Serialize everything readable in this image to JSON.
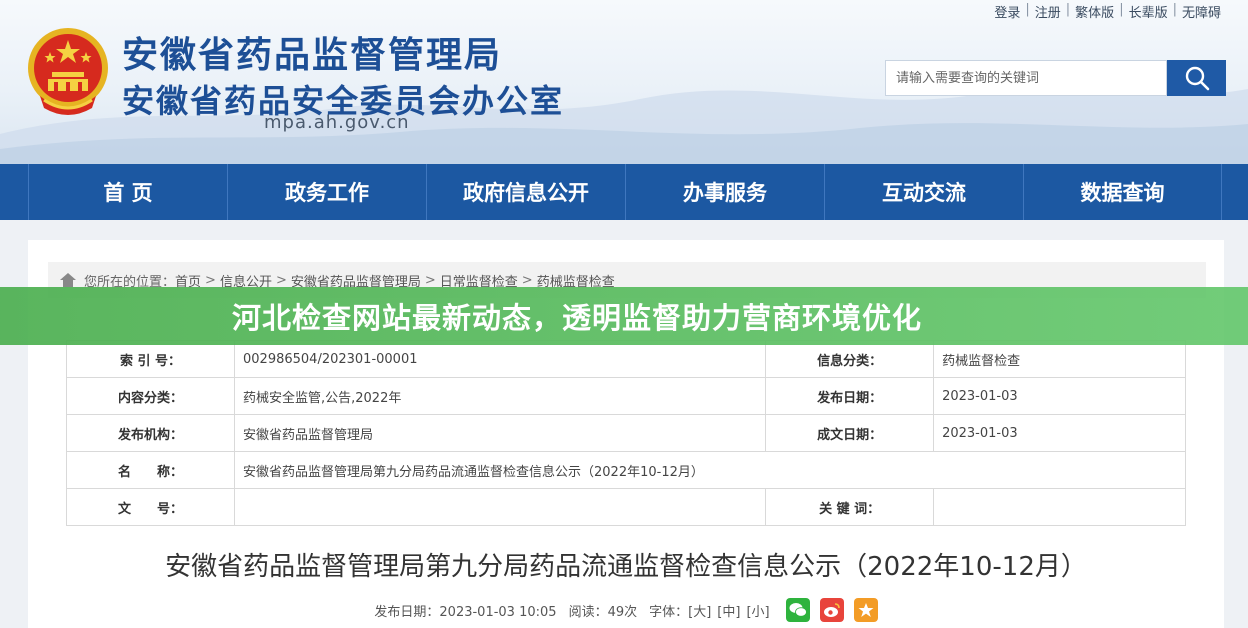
{
  "header": {
    "title_main": "安徽省药品监督管理局",
    "title_sub": "安徽省药品安全委员会办公室",
    "domain": "mpa.ah.gov.cn",
    "top_links": [
      "登录",
      "注册",
      "繁体版",
      "长辈版",
      "无障碍"
    ],
    "search_placeholder": "请输入需要查询的关键词",
    "accent_color": "#1d4f96"
  },
  "nav": {
    "items": [
      "首 页",
      "政务工作",
      "政府信息公开",
      "办事服务",
      "互动交流",
      "数据查询"
    ],
    "bg_color": "#1c58a2"
  },
  "breadcrumb": {
    "prefix": "您所在的位置：",
    "items": [
      "首页",
      "信息公开",
      "安徽省药品监督管理局",
      "日常监督检查",
      "药械监督检查"
    ]
  },
  "info": {
    "rows": [
      {
        "l1": "索 引 号：",
        "v1": "002986504/202301-00001",
        "l2": "信息分类：",
        "v2": "药械监督检查"
      },
      {
        "l1": "内容分类：",
        "v1": "药械安全监管,公告,2022年",
        "l2": "发布日期：",
        "v2": "2023-01-03"
      },
      {
        "l1": "发布机构：",
        "v1": "安徽省药品监督管理局",
        "l2": "成文日期：",
        "v2": "2023-01-03"
      },
      {
        "l1": "名　　称：",
        "v1": "安徽省药品监督管理局第九分局药品流通监督检查信息公示（2022年10-12月）"
      },
      {
        "l1": "文　　号：",
        "v1": "",
        "l2": "关 键 词：",
        "v2": ""
      }
    ]
  },
  "article": {
    "title": "安徽省药品监督管理局第九分局药品流通监督检查信息公示（2022年10-12月）",
    "publish_date": "发布日期：2023-01-03 10:05",
    "views": "阅读：49次",
    "font_label": "字体：",
    "font_sizes": [
      "[大]",
      "[中]",
      "[小]"
    ]
  },
  "banner": {
    "text": "河北检查网站最新动态，透明监督助力营商环境优化",
    "color": "#4caf50"
  }
}
